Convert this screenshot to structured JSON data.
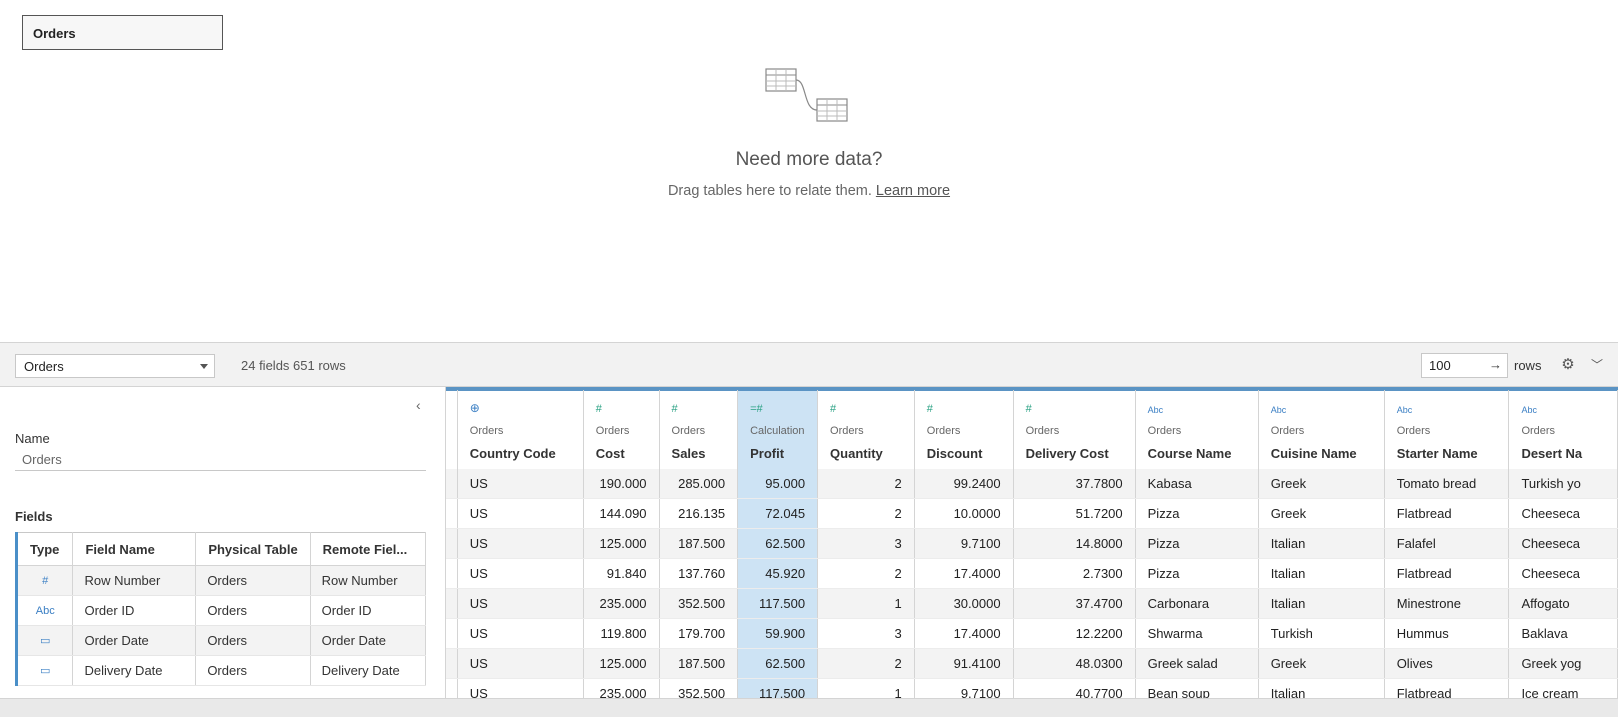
{
  "canvas": {
    "table_chip": "Orders",
    "need_title": "Need more data?",
    "need_sub": "Drag tables here to relate them.",
    "learn_more": "Learn more"
  },
  "toolbar": {
    "table_select": "Orders",
    "summary": "24 fields 651 rows",
    "rows_value": "100",
    "rows_label": "rows"
  },
  "left_panel": {
    "name_label": "Name",
    "name_value": "Orders",
    "fields_label": "Fields",
    "headers": [
      "Type",
      "Field Name",
      "Physical Table",
      "Remote Fiel..."
    ],
    "rows": [
      {
        "type": "#",
        "name": "Row Number",
        "table": "Orders",
        "remote": "Row Number"
      },
      {
        "type": "Abc",
        "name": "Order ID",
        "table": "Orders",
        "remote": "Order ID"
      },
      {
        "type": "▭",
        "name": "Order Date",
        "table": "Orders",
        "remote": "Order Date"
      },
      {
        "type": "▭",
        "name": "Delivery Date",
        "table": "Orders",
        "remote": "Delivery Date"
      }
    ]
  },
  "grid": {
    "columns": [
      {
        "icon": "⊕",
        "source": "Orders",
        "name": "Country Code"
      },
      {
        "icon": "#",
        "source": "Orders",
        "name": "Cost"
      },
      {
        "icon": "#",
        "source": "Orders",
        "name": "Sales"
      },
      {
        "icon": "=#",
        "source": "Calculation",
        "name": "Profit"
      },
      {
        "icon": "#",
        "source": "Orders",
        "name": "Quantity"
      },
      {
        "icon": "#",
        "source": "Orders",
        "name": "Discount"
      },
      {
        "icon": "#",
        "source": "Orders",
        "name": "Delivery Cost"
      },
      {
        "icon": "Abc",
        "source": "Orders",
        "name": "Course Name"
      },
      {
        "icon": "Abc",
        "source": "Orders",
        "name": "Cuisine Name"
      },
      {
        "icon": "Abc",
        "source": "Orders",
        "name": "Starter Name"
      },
      {
        "icon": "Abc",
        "source": "Orders",
        "name": "Desert Na"
      }
    ],
    "rows": [
      [
        "US",
        "190.000",
        "285.000",
        "95.000",
        "2",
        "99.2400",
        "37.7800",
        "Kabasa",
        "Greek",
        "Tomato bread",
        "Turkish yo"
      ],
      [
        "US",
        "144.090",
        "216.135",
        "72.045",
        "2",
        "10.0000",
        "51.7200",
        "Pizza",
        "Greek",
        "Flatbread",
        "Cheeseca"
      ],
      [
        "US",
        "125.000",
        "187.500",
        "62.500",
        "3",
        "9.7100",
        "14.8000",
        "Pizza",
        "Italian",
        "Falafel",
        "Cheeseca"
      ],
      [
        "US",
        "91.840",
        "137.760",
        "45.920",
        "2",
        "17.4000",
        "2.7300",
        "Pizza",
        "Italian",
        "Flatbread",
        "Cheeseca"
      ],
      [
        "US",
        "235.000",
        "352.500",
        "117.500",
        "1",
        "30.0000",
        "37.4700",
        "Carbonara",
        "Italian",
        "Minestrone",
        "Affogato"
      ],
      [
        "US",
        "119.800",
        "179.700",
        "59.900",
        "3",
        "17.4000",
        "12.2200",
        "Shwarma",
        "Turkish",
        "Hummus",
        "Baklava"
      ],
      [
        "US",
        "125.000",
        "187.500",
        "62.500",
        "2",
        "91.4100",
        "48.0300",
        "Greek salad",
        "Greek",
        "Olives",
        "Greek yog"
      ],
      [
        "US",
        "235.000",
        "352.500",
        "117.500",
        "1",
        "9.7100",
        "40.7700",
        "Bean soup",
        "Italian",
        "Flatbread",
        "Ice cream"
      ]
    ]
  }
}
